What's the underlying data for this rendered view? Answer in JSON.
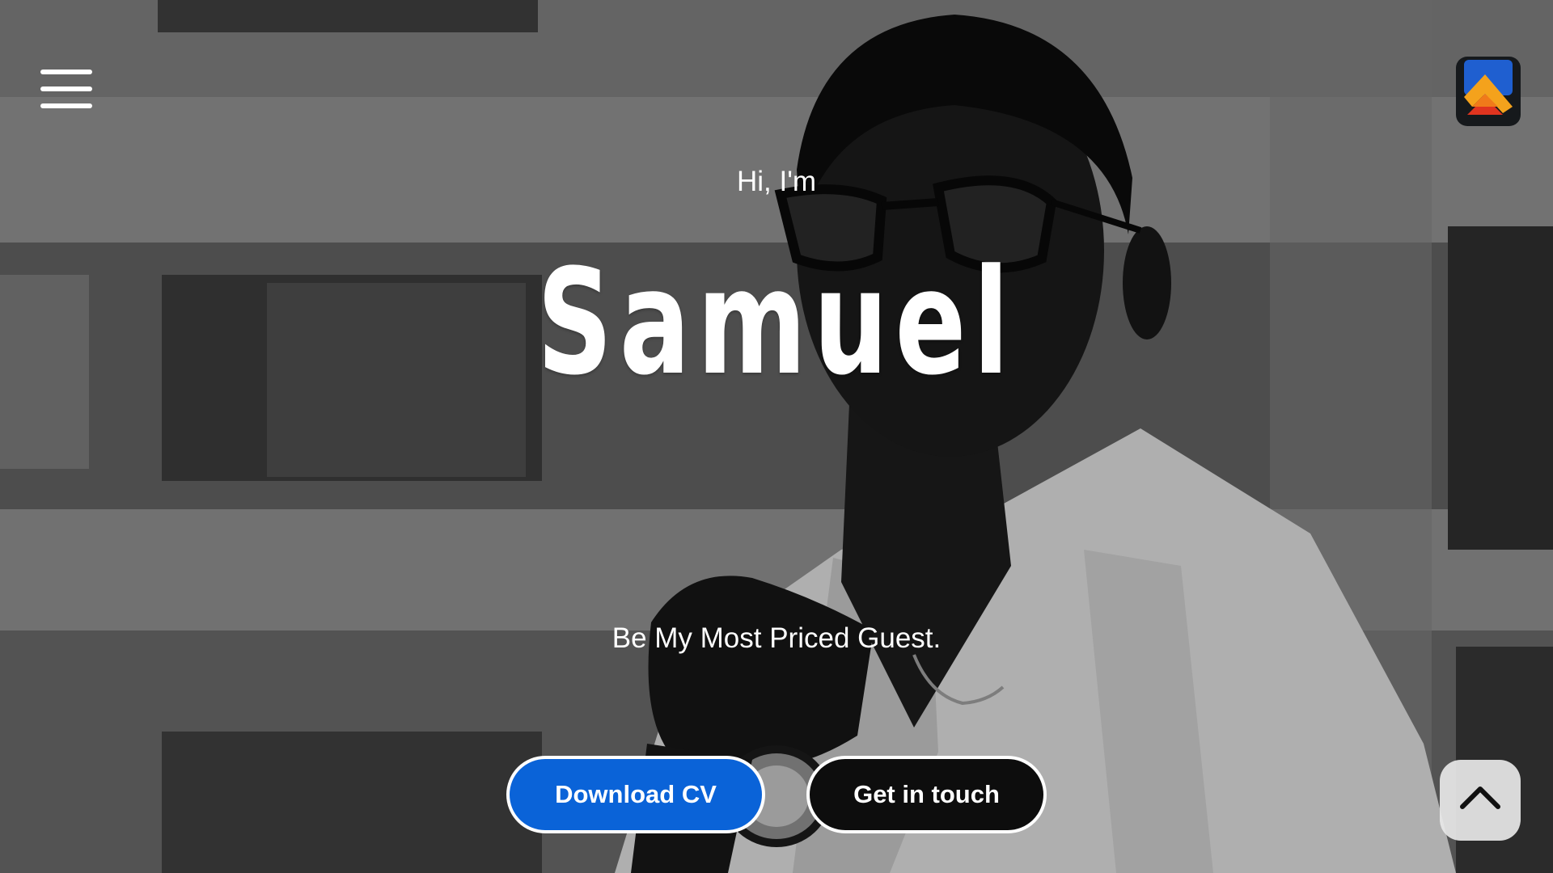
{
  "hero": {
    "greeting": "Hi, I'm",
    "name": "Samuel",
    "tagline": "Be My Most Priced Guest.",
    "background": "grayscale-portrait-photo"
  },
  "buttons": {
    "download_cv": "Download CV",
    "get_in_touch": "Get in touch"
  },
  "icons": {
    "menu": "hamburger-menu-icon",
    "logo": "app-logo-icon",
    "scroll_top": "chevron-up-icon"
  },
  "colors": {
    "primary_button": "#0a63d8",
    "secondary_button": "#0d0d0d",
    "text": "#ffffff"
  }
}
